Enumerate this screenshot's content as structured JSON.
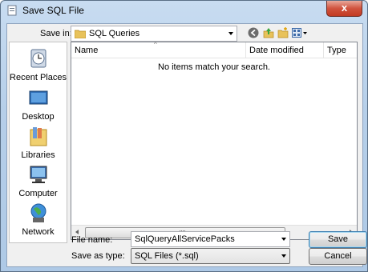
{
  "window": {
    "title": "Save SQL File",
    "close_glyph": "x"
  },
  "toolbar": {
    "save_in_label": "Save in:",
    "save_in_value": "SQL Queries",
    "icons": [
      "back-icon",
      "up-folder-icon",
      "new-folder-icon",
      "view-menu-icon"
    ]
  },
  "places": [
    {
      "label": "Recent Places",
      "icon": "recent-places-icon"
    },
    {
      "label": "Desktop",
      "icon": "desktop-icon"
    },
    {
      "label": "Libraries",
      "icon": "libraries-icon"
    },
    {
      "label": "Computer",
      "icon": "computer-icon"
    },
    {
      "label": "Network",
      "icon": "network-icon"
    }
  ],
  "list": {
    "columns": [
      "Name",
      "Date modified",
      "Type"
    ],
    "empty_message": "No items match your search."
  },
  "form": {
    "file_name_label": "File name:",
    "file_name_value": "SqlQueryAllServicePacks",
    "save_as_type_label": "Save as type:",
    "save_as_type_value": "SQL Files (*.sql)"
  },
  "buttons": {
    "save": "Save",
    "cancel": "Cancel"
  },
  "colors": {
    "title_bar": "#b6cfe9",
    "close_button": "#c94a33",
    "dialog_bg": "#f0f0f0"
  }
}
